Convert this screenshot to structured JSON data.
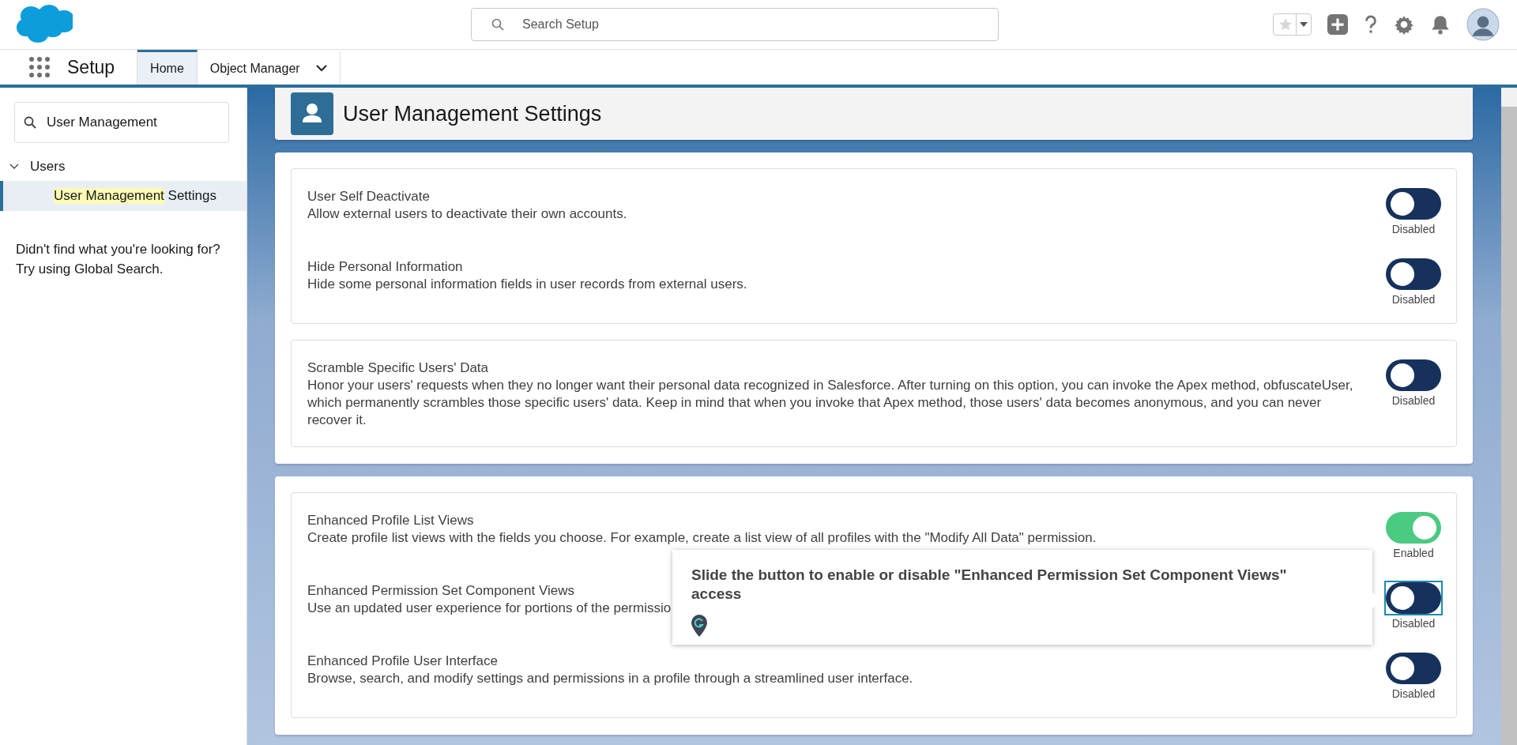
{
  "header": {
    "search": {
      "placeholder": "Search Setup"
    }
  },
  "nav": {
    "app_name": "Setup",
    "tabs": [
      {
        "label": "Home",
        "selected": true,
        "kind": "plain"
      },
      {
        "label": "Object Manager",
        "selected": false,
        "kind": "dropdown"
      }
    ]
  },
  "sidebar": {
    "search": {
      "value": "User Management"
    },
    "tree": [
      {
        "label": "Users",
        "expanded": true,
        "children": [
          {
            "match": "User Management",
            "rest": " Settings",
            "selected": true
          }
        ]
      }
    ],
    "help": [
      "Didn't find what you're looking for?",
      "Try using Global Search."
    ]
  },
  "page": {
    "title": "User Management Settings"
  },
  "cards": [
    {
      "groups": [
        {
          "settings": [
            {
              "title": "User Self Deactivate",
              "description": "Allow external users to deactivate their own accounts.",
              "on": false,
              "status": "Disabled",
              "focused": false
            },
            {
              "title": "Hide Personal Information",
              "description": "Hide some personal information fields in user records from external users.",
              "on": false,
              "status": "Disabled",
              "focused": false
            }
          ]
        },
        {
          "settings": [
            {
              "title": "Scramble Specific Users' Data",
              "description": "Honor your users' requests when they no longer want their personal data recognized in Salesforce. After turning on this option, you can invoke the Apex method, obfuscateUser, which permanently scrambles those specific users' data. Keep in mind that when you invoke that Apex method, those users' data becomes anonymous, and you can never recover it.",
              "on": false,
              "status": "Disabled",
              "focused": false
            }
          ]
        }
      ]
    },
    {
      "groups": [
        {
          "settings": [
            {
              "title": "Enhanced Profile List Views",
              "description": "Create profile list views with the fields you choose. For example, create a list view of all profiles with the \"Modify All Data\" permission.",
              "on": true,
              "status": "Enabled",
              "focused": false
            },
            {
              "title": "Enhanced Permission Set Component Views",
              "description": "Use an updated user experience for portions of the permissio",
              "on": false,
              "status": "Disabled",
              "focused": true
            },
            {
              "title": "Enhanced Profile User Interface",
              "description": "Browse, search, and modify settings and permissions in a profile through a streamlined user interface.",
              "on": false,
              "status": "Disabled",
              "focused": false
            }
          ]
        }
      ]
    }
  ],
  "tooltip": {
    "text": "Slide the button to enable or disable \"Enhanced Permission Set Component Views\" access"
  }
}
